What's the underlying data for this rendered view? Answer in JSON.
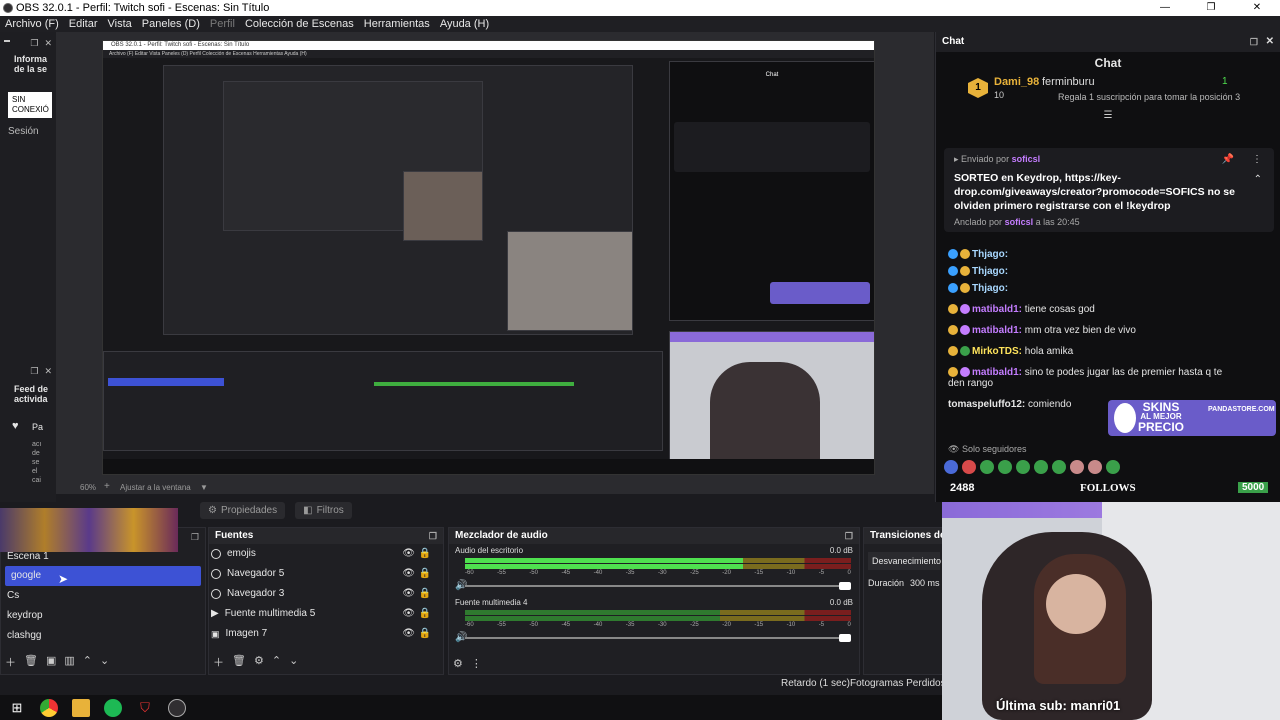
{
  "window": {
    "title": "OBS 32.0.1 - Perfil: Twitch sofi - Escenas: Sin Título",
    "minimize": "—",
    "maximize": "❐",
    "close": "✕"
  },
  "menu": [
    "Archivo (F)",
    "Editar",
    "Vista",
    "Paneles (D)",
    "Perfil",
    "Colección de Escenas",
    "Herramientas",
    "Ayuda (H)"
  ],
  "left_dock": {
    "title": "Informa de la se",
    "status": "SIN CONEXIÓ",
    "session": "Sesión"
  },
  "left_dock2": {
    "title": "Feed de activida",
    "item": "Pa",
    "snippet": "acı de se el cai"
  },
  "zoom": {
    "level": "60%",
    "fit_label": "Ajustar a la ventana"
  },
  "tabs": {
    "properties": "Propiedades",
    "filters": "Filtros"
  },
  "scenes": {
    "items": [
      "Escena 1",
      "google",
      "Cs",
      "keydrop",
      "clashgg"
    ],
    "selected_index": 1
  },
  "sources": {
    "title": "Fuentes",
    "items": [
      "emojis",
      "Navegador 5",
      "Navegador 3",
      "Fuente multimedia 5",
      "Imagen 7"
    ]
  },
  "mixer": {
    "title": "Mezclador de audio",
    "channels": [
      {
        "name": "Audio del escritorio",
        "db": "0.0 dB",
        "level": 0.72
      },
      {
        "name": "Fuente multimedia 4",
        "db": "0.0 dB",
        "level": 0.0
      }
    ],
    "ticks": [
      "-60",
      "-55",
      "-50",
      "-45",
      "-40",
      "-35",
      "-30",
      "-25",
      "-20",
      "-15",
      "-10",
      "-5",
      "0"
    ]
  },
  "transitions": {
    "title": "Transiciones de e",
    "type": "Desvanecimiento",
    "duration_label": "Duración",
    "duration_value": "300 ms"
  },
  "status": {
    "delay": "Retardo (1 sec)",
    "dropped": "Fotogramas Perdidos 0"
  },
  "chat": {
    "dock_title": "Chat",
    "header": "Chat",
    "top_gifter": {
      "name": "Dami_98",
      "count": "10",
      "rank": "1"
    },
    "gift_sub": {
      "name": "ferminburu",
      "text": "Regala 1 suscripción para tomar la posición 3"
    },
    "pinned": {
      "sent_by_label": "Enviado por",
      "sent_by": "soficsl",
      "text": "SORTEO en Keydrop, https://key-drop.com/giveaways/creator?promocode=SOFICS no se olviden primero registrarse con el !keydrop",
      "pinned_by_label": "Anclado por",
      "pinned_by": "soficsl",
      "time": "a las 20:45"
    },
    "messages": [
      {
        "user": "Thjago:",
        "text": "",
        "color": "#a9d8ff"
      },
      {
        "user": "Thjago:",
        "text": "",
        "color": "#a9d8ff"
      },
      {
        "user": "Thjago:",
        "text": "",
        "color": "#a9d8ff"
      },
      {
        "user": "matibald1:",
        "text": "tiene cosas god",
        "color": "#c47dff"
      },
      {
        "user": "matibald1:",
        "text": "mm otra vez bien de vivo",
        "color": "#c47dff"
      },
      {
        "user": "MirkoTDS:",
        "text": "hola amika",
        "color": "#ffe45c"
      },
      {
        "user": "matibald1:",
        "text": "sino te podes jugar las de premier hasta q te den rango",
        "color": "#c47dff"
      },
      {
        "user": "tomaspeluffo12:",
        "text": "comiendo",
        "color": "#e6e6e6"
      }
    ],
    "followers_only": "Solo seguidores",
    "ad": {
      "line1": "SKINS",
      "line2": "AL MEJOR",
      "line3": "PRECIO",
      "site": "PANDASTORE.COM"
    }
  },
  "overlay": {
    "followers": "2488",
    "label": "FOLLOWS",
    "goal": "5000",
    "last_sub": "Última sub: manri01"
  }
}
